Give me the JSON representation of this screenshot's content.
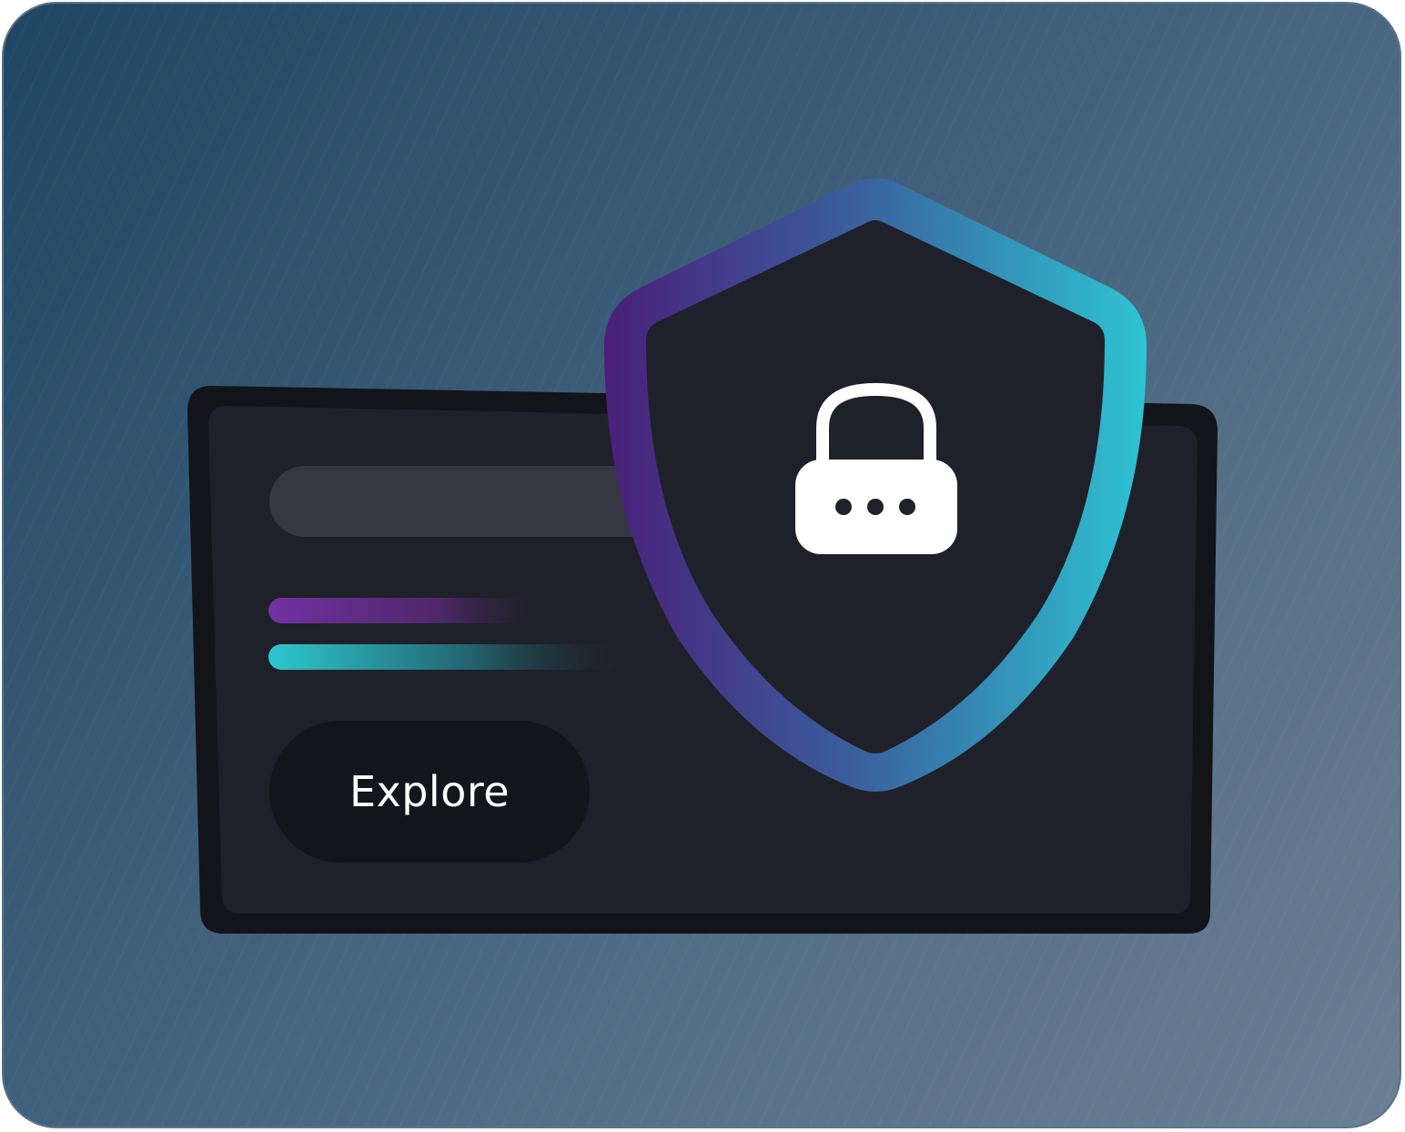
{
  "card": {
    "button_label": "Explore"
  },
  "icons": {
    "shield": "shield-icon",
    "lock": "lock-icon"
  },
  "colors": {
    "accent_purple": "#6a2a96",
    "accent_cyan": "#2ec4d2",
    "card_dark": "#1f212a",
    "card_border": "#12141a"
  }
}
